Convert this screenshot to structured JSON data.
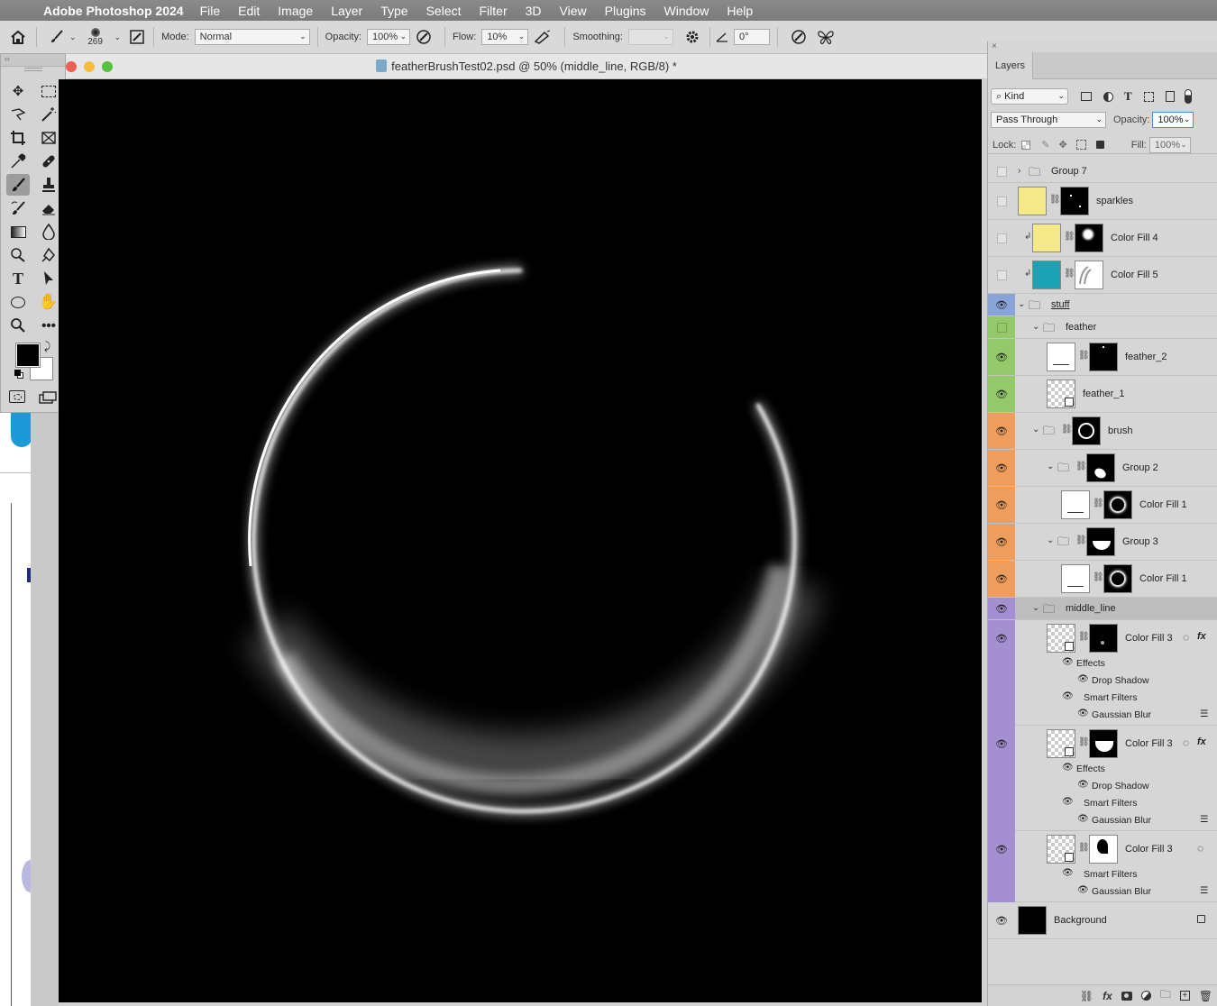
{
  "menubar": {
    "app_name": "Adobe Photoshop 2024",
    "items": [
      "File",
      "Edit",
      "Image",
      "Layer",
      "Type",
      "Select",
      "Filter",
      "3D",
      "View",
      "Plugins",
      "Window",
      "Help"
    ]
  },
  "options": {
    "brush_size": "269",
    "mode_label": "Mode:",
    "mode_value": "Normal",
    "opacity_label": "Opacity:",
    "opacity_value": "100%",
    "flow_label": "Flow:",
    "flow_value": "10%",
    "smoothing_label": "Smoothing:",
    "smoothing_value": "",
    "angle_value": "0°"
  },
  "document": {
    "title": "featherBrushTest02.psd @ 50% (middle_line, RGB/8) *"
  },
  "layers_panel": {
    "tab_label": "Layers",
    "kind_label": "Kind",
    "blend_mode": "Pass Through",
    "opacity_label": "Opacity:",
    "opacity_value": "100%",
    "lock_label": "Lock:",
    "fill_label": "Fill:",
    "fill_value": "100%",
    "layers": {
      "group7": "Group 7",
      "sparkles": "sparkles",
      "colorfill4": "Color Fill 4",
      "colorfill5": "Color Fill 5",
      "stuff": "stuff",
      "feather": "feather",
      "feather2": "feather_2",
      "feather1": "feather_1",
      "brush": "brush",
      "group2": "Group 2",
      "colorfill1a": "Color Fill 1",
      "group3": "Group 3",
      "colorfill1b": "Color Fill 1",
      "middle_line": "middle_line",
      "colorfill3a": "Color Fill 3",
      "colorfill3b": "Color Fill 3",
      "colorfill3c": "Color Fill 3",
      "background": "Background"
    },
    "sub_labels": {
      "effects": "Effects",
      "drop_shadow": "Drop Shadow",
      "smart_filters": "Smart Filters",
      "gaussian_blur": "Gaussian Blur"
    },
    "fx_label": "fx",
    "colors": {
      "yellow": "#f5e98a",
      "teal": "#1aa3b3",
      "blue_tag": "#8aa4d8",
      "green_tag": "#93c96a",
      "orange_tag": "#ef9d5c",
      "purple_tag": "#a48fd0"
    }
  }
}
